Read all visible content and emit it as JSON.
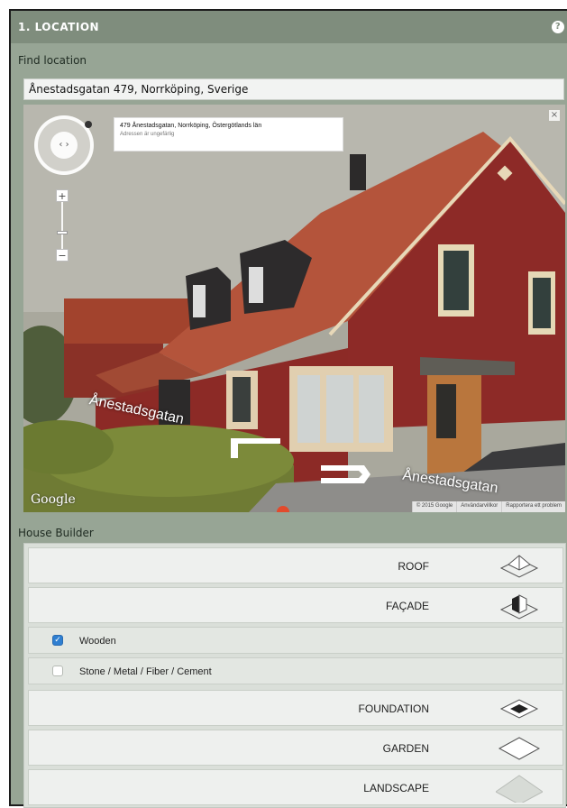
{
  "section": {
    "title": "1. LOCATION",
    "help_glyph": "?"
  },
  "find_location": {
    "label": "Find location",
    "value": "Ånestadsgatan 479, Norrköping, Sverige"
  },
  "street_view": {
    "address_title": "479 Ånestadsgatan, Norrköping, Östergötlands län",
    "address_note": "Adressen är ungefärlig",
    "close_glyph": "×",
    "zoom_in": "+",
    "zoom_out": "−",
    "nav_glyph": "‹ ›",
    "street_label_left": "Ånestadsgatan",
    "street_label_right": "Ånestadsgatan",
    "google_logo": "Google",
    "footer": [
      "© 2015 Google",
      "Användarvillkor",
      "Rapportera ett problem"
    ]
  },
  "house_builder": {
    "label": "House Builder",
    "sections": [
      {
        "label": "ROOF",
        "icon": "roof-icon"
      },
      {
        "label": "FAÇADE",
        "icon": "facade-icon"
      },
      {
        "label": "FOUNDATION",
        "icon": "foundation-icon"
      },
      {
        "label": "GARDEN",
        "icon": "garden-icon"
      },
      {
        "label": "LANDSCAPE",
        "icon": "landscape-icon"
      }
    ],
    "facade_options": [
      {
        "label": "Wooden",
        "checked": true
      },
      {
        "label": "Stone / Metal / Fiber / Cement",
        "checked": false
      }
    ]
  },
  "colors": {
    "panel_bg": "#97a595",
    "header_bg": "#7f8d7d",
    "checkbox_checked": "#2f7fd1"
  }
}
